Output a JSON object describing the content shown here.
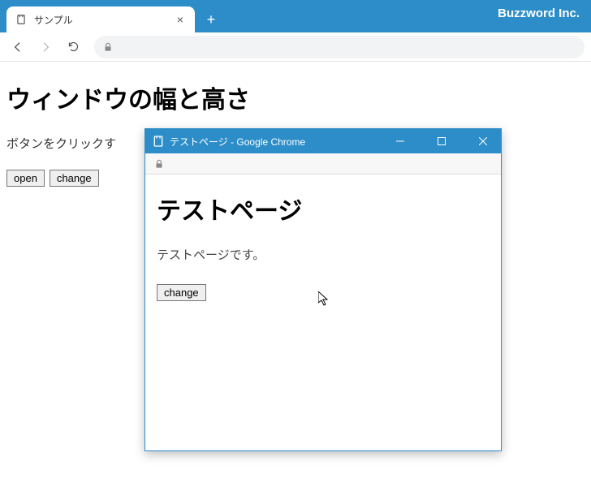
{
  "brand": "Buzzword Inc.",
  "browser": {
    "tab_title": "サンプル",
    "new_tab": "+",
    "close_tab": "×"
  },
  "page": {
    "heading": "ウィンドウの幅と高さ",
    "instruction": "ボタンをクリックす",
    "buttons": {
      "open": "open",
      "change": "change"
    }
  },
  "popup": {
    "title": "テストページ - Google Chrome",
    "heading": "テストページ",
    "paragraph": "テストページです。",
    "buttons": {
      "change": "change"
    }
  }
}
